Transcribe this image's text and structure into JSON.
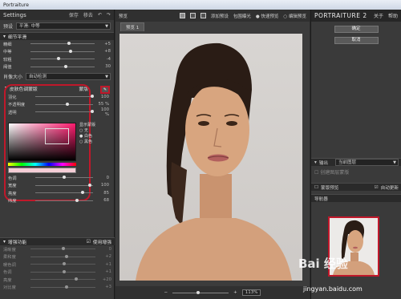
{
  "window": {
    "title": "Portraiture"
  },
  "left": {
    "header": {
      "title": "Settings",
      "save_label": "保存",
      "delete_label": "移去"
    },
    "preset": {
      "label": "预设",
      "value": "平滑: 中等"
    },
    "detail": {
      "title": "细节平滑",
      "sliders": [
        {
          "label": "精细",
          "value": "+5",
          "level": 0.6
        },
        {
          "label": "中等",
          "value": "+8",
          "level": 0.62
        },
        {
          "label": "较粗",
          "value": "-4",
          "level": 0.44
        },
        {
          "label": "阈值",
          "value": "30",
          "level": 0.55
        }
      ],
      "size": {
        "label": "肖像大小",
        "value": "自动检测"
      }
    },
    "mask": {
      "title": "皮肤色调蒙版",
      "right_label": "蒙版",
      "sliders": [
        {
          "label": "羽化",
          "value": "100",
          "level": 0.98
        },
        {
          "label": "不透明度",
          "value": "55 %",
          "level": 0.55
        },
        {
          "label": "透明",
          "value": "100 %",
          "level": 0.98
        }
      ],
      "radios": [
        "显示蒙版",
        "无",
        "白色",
        "黑色"
      ],
      "sliders2": [
        {
          "label": "色调",
          "value": "0",
          "level": 0.5
        },
        {
          "label": "宽度",
          "value": "100",
          "level": 0.95
        },
        {
          "label": "亮度",
          "value": "85",
          "level": 0.82
        },
        {
          "label": "纬度",
          "value": "68",
          "level": 0.72
        }
      ]
    },
    "enhance": {
      "title": "增强功能",
      "use_label": "使用增强",
      "sliders": [
        {
          "label": "清晰度",
          "value": "0",
          "level": 0.5
        },
        {
          "label": "柔和度",
          "value": "+2",
          "level": 0.55
        },
        {
          "label": "暖色调",
          "value": "+1",
          "level": 0.52
        },
        {
          "label": "色调",
          "value": "+1",
          "level": 0.52
        },
        {
          "label": "亮度",
          "value": "+20",
          "level": 0.7
        },
        {
          "label": "对比度",
          "value": "+3",
          "level": 0.56
        }
      ]
    }
  },
  "center": {
    "toolbar": {
      "preview": "预览",
      "add_preset": "添加预设",
      "exposure": "包围曝光",
      "quick": "快速预览",
      "editor": "编辑预览"
    },
    "tab": "预览 1",
    "zoom": "113%"
  },
  "right": {
    "logo": "PORTRAITURE 2",
    "about": "关于",
    "help": "帮助",
    "ok": "确定",
    "cancel": "取消",
    "output": {
      "title": "输出",
      "value": "当前图层",
      "checkbox": "创建图层蒙版"
    },
    "mask_preview": "蒙版预览",
    "auto_update": "自动更新",
    "navigator": "导航器"
  },
  "watermark": {
    "brand": "Bai 经验",
    "url": "jingyan.baidu.com"
  }
}
